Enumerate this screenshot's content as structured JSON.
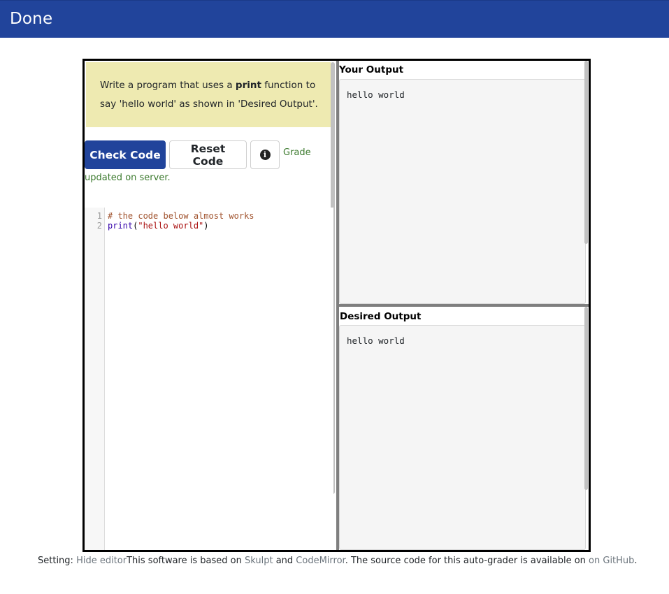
{
  "header": {
    "title": "Done"
  },
  "instructions": {
    "part1": "Write a program that uses a ",
    "keyword": "print",
    "part2": " function to say 'hello world' as shown in 'Desired Output'."
  },
  "buttons": {
    "check": "Check Code",
    "reset": "Reset Code",
    "info_icon": "info-circle-icon"
  },
  "status": {
    "line1": "Grade",
    "line2": "updated on server."
  },
  "editor": {
    "lines": [
      {
        "number": "1",
        "comment": "# the code below almost works"
      },
      {
        "number": "2",
        "builtin": "print",
        "open": "(",
        "string": "\"hello world\"",
        "close": ")"
      }
    ]
  },
  "your_output": {
    "label": "Your Output",
    "text": "hello world"
  },
  "desired_output": {
    "label": "Desired Output",
    "text": "hello world"
  },
  "footer": {
    "setting_label": "Setting: ",
    "hide_editor": "Hide editor",
    "based_on": "This software is based on ",
    "skulpt": "Skulpt",
    "and": " and ",
    "codemirror": "CodeMirror",
    "source_text": ". The source code for this auto-grader is available on ",
    "github": "on GitHub",
    "period": "."
  },
  "colors": {
    "brand": "#21449b",
    "instructions_bg": "#eeeab1",
    "status_green": "#3c7a2e"
  }
}
